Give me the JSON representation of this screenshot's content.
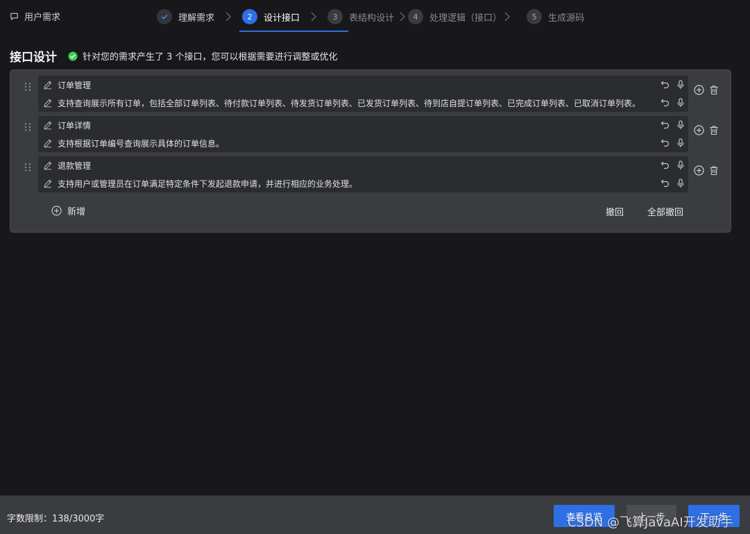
{
  "top_bar": {
    "requirement_tab": "用户需求",
    "steps": [
      {
        "number": "1",
        "label": "理解需求",
        "state": "done"
      },
      {
        "number": "2",
        "label": "设计接口",
        "state": "active"
      },
      {
        "number": "3",
        "label": "表结构设计",
        "state": "pending"
      },
      {
        "number": "4",
        "label": "处理逻辑（接口）",
        "state": "pending"
      },
      {
        "number": "5",
        "label": "生成源码",
        "state": "pending"
      }
    ]
  },
  "heading": {
    "title": "接口设计",
    "hint": "针对您的需求产生了 3 个接口，您可以根据需要进行调整或优化"
  },
  "interfaces": [
    {
      "title": "订单管理",
      "description": "支持查询展示所有订单，包括全部订单列表、待付款订单列表、待发货订单列表、已发货订单列表、待到店自提订单列表、已完成订单列表、已取消订单列表。"
    },
    {
      "title": "订单详情",
      "description": "支持根据订单编号查询展示具体的订单信息。"
    },
    {
      "title": "退款管理",
      "description": "支持用户或管理员在订单满足特定条件下发起退款申请，并进行相应的业务处理。"
    }
  ],
  "actions": {
    "add": "新增",
    "undo": "撤回",
    "undo_all": "全部撤回"
  },
  "footer": {
    "char_limit": "字数限制：138/3000字",
    "overview": "查看总览",
    "prev": "上一步",
    "next": "下一步"
  },
  "watermark": "CSDN @飞算JavaAI开发助手",
  "colors": {
    "accent": "#2f6fe4",
    "success": "#3fcf5a",
    "background": "#18181b",
    "panel": "#3a3c40"
  }
}
